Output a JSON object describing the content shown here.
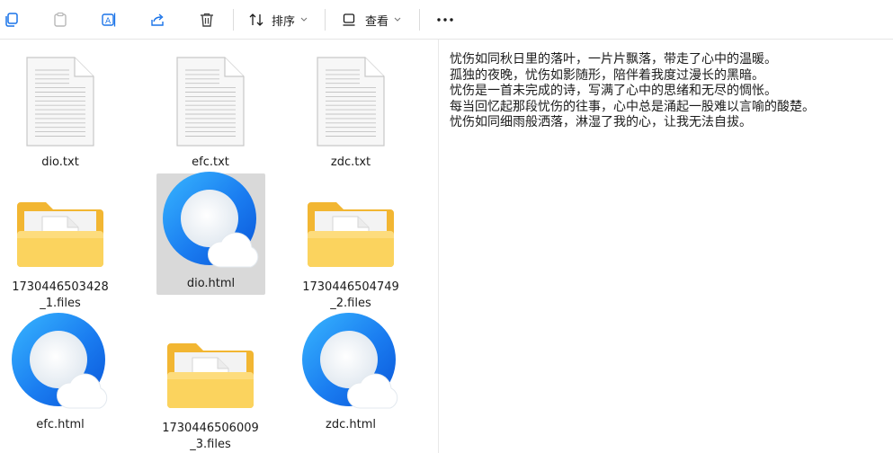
{
  "toolbar": {
    "sort_label": "排序",
    "view_label": "查看"
  },
  "files": [
    {
      "name": "dio.txt",
      "type": "text-file-icon"
    },
    {
      "name": "efc.txt",
      "type": "text-file-icon"
    },
    {
      "name": "zdc.txt",
      "type": "text-file-icon"
    },
    {
      "name": "1730446503428\n_1.files",
      "type": "folder-icon"
    },
    {
      "name": "dio.html",
      "type": "browser-html-icon",
      "selected": true
    },
    {
      "name": "1730446504749\n_2.files",
      "type": "folder-icon"
    },
    {
      "name": "efc.html",
      "type": "browser-html-icon"
    },
    {
      "name": "1730446506009\n_3.files",
      "type": "folder-icon"
    },
    {
      "name": "zdc.html",
      "type": "browser-html-icon"
    }
  ],
  "preview": {
    "lines": [
      "忧伤如同秋日里的落叶，一片片飘落，带走了心中的温暖。",
      "孤独的夜晚，忧伤如影随形，陪伴着我度过漫长的黑暗。",
      "忧伤是一首未完成的诗，写满了心中的思绪和无尽的惆怅。",
      "每当回忆起那段忧伤的往事，心中总是涌起一股难以言喻的酸楚。",
      "忧伤如同细雨般洒落，淋湿了我的心，让我无法自拔。"
    ]
  },
  "colors": {
    "accent": "#1a73e8",
    "folder": "#f6c445",
    "selected_bg": "#d9d9d9"
  }
}
